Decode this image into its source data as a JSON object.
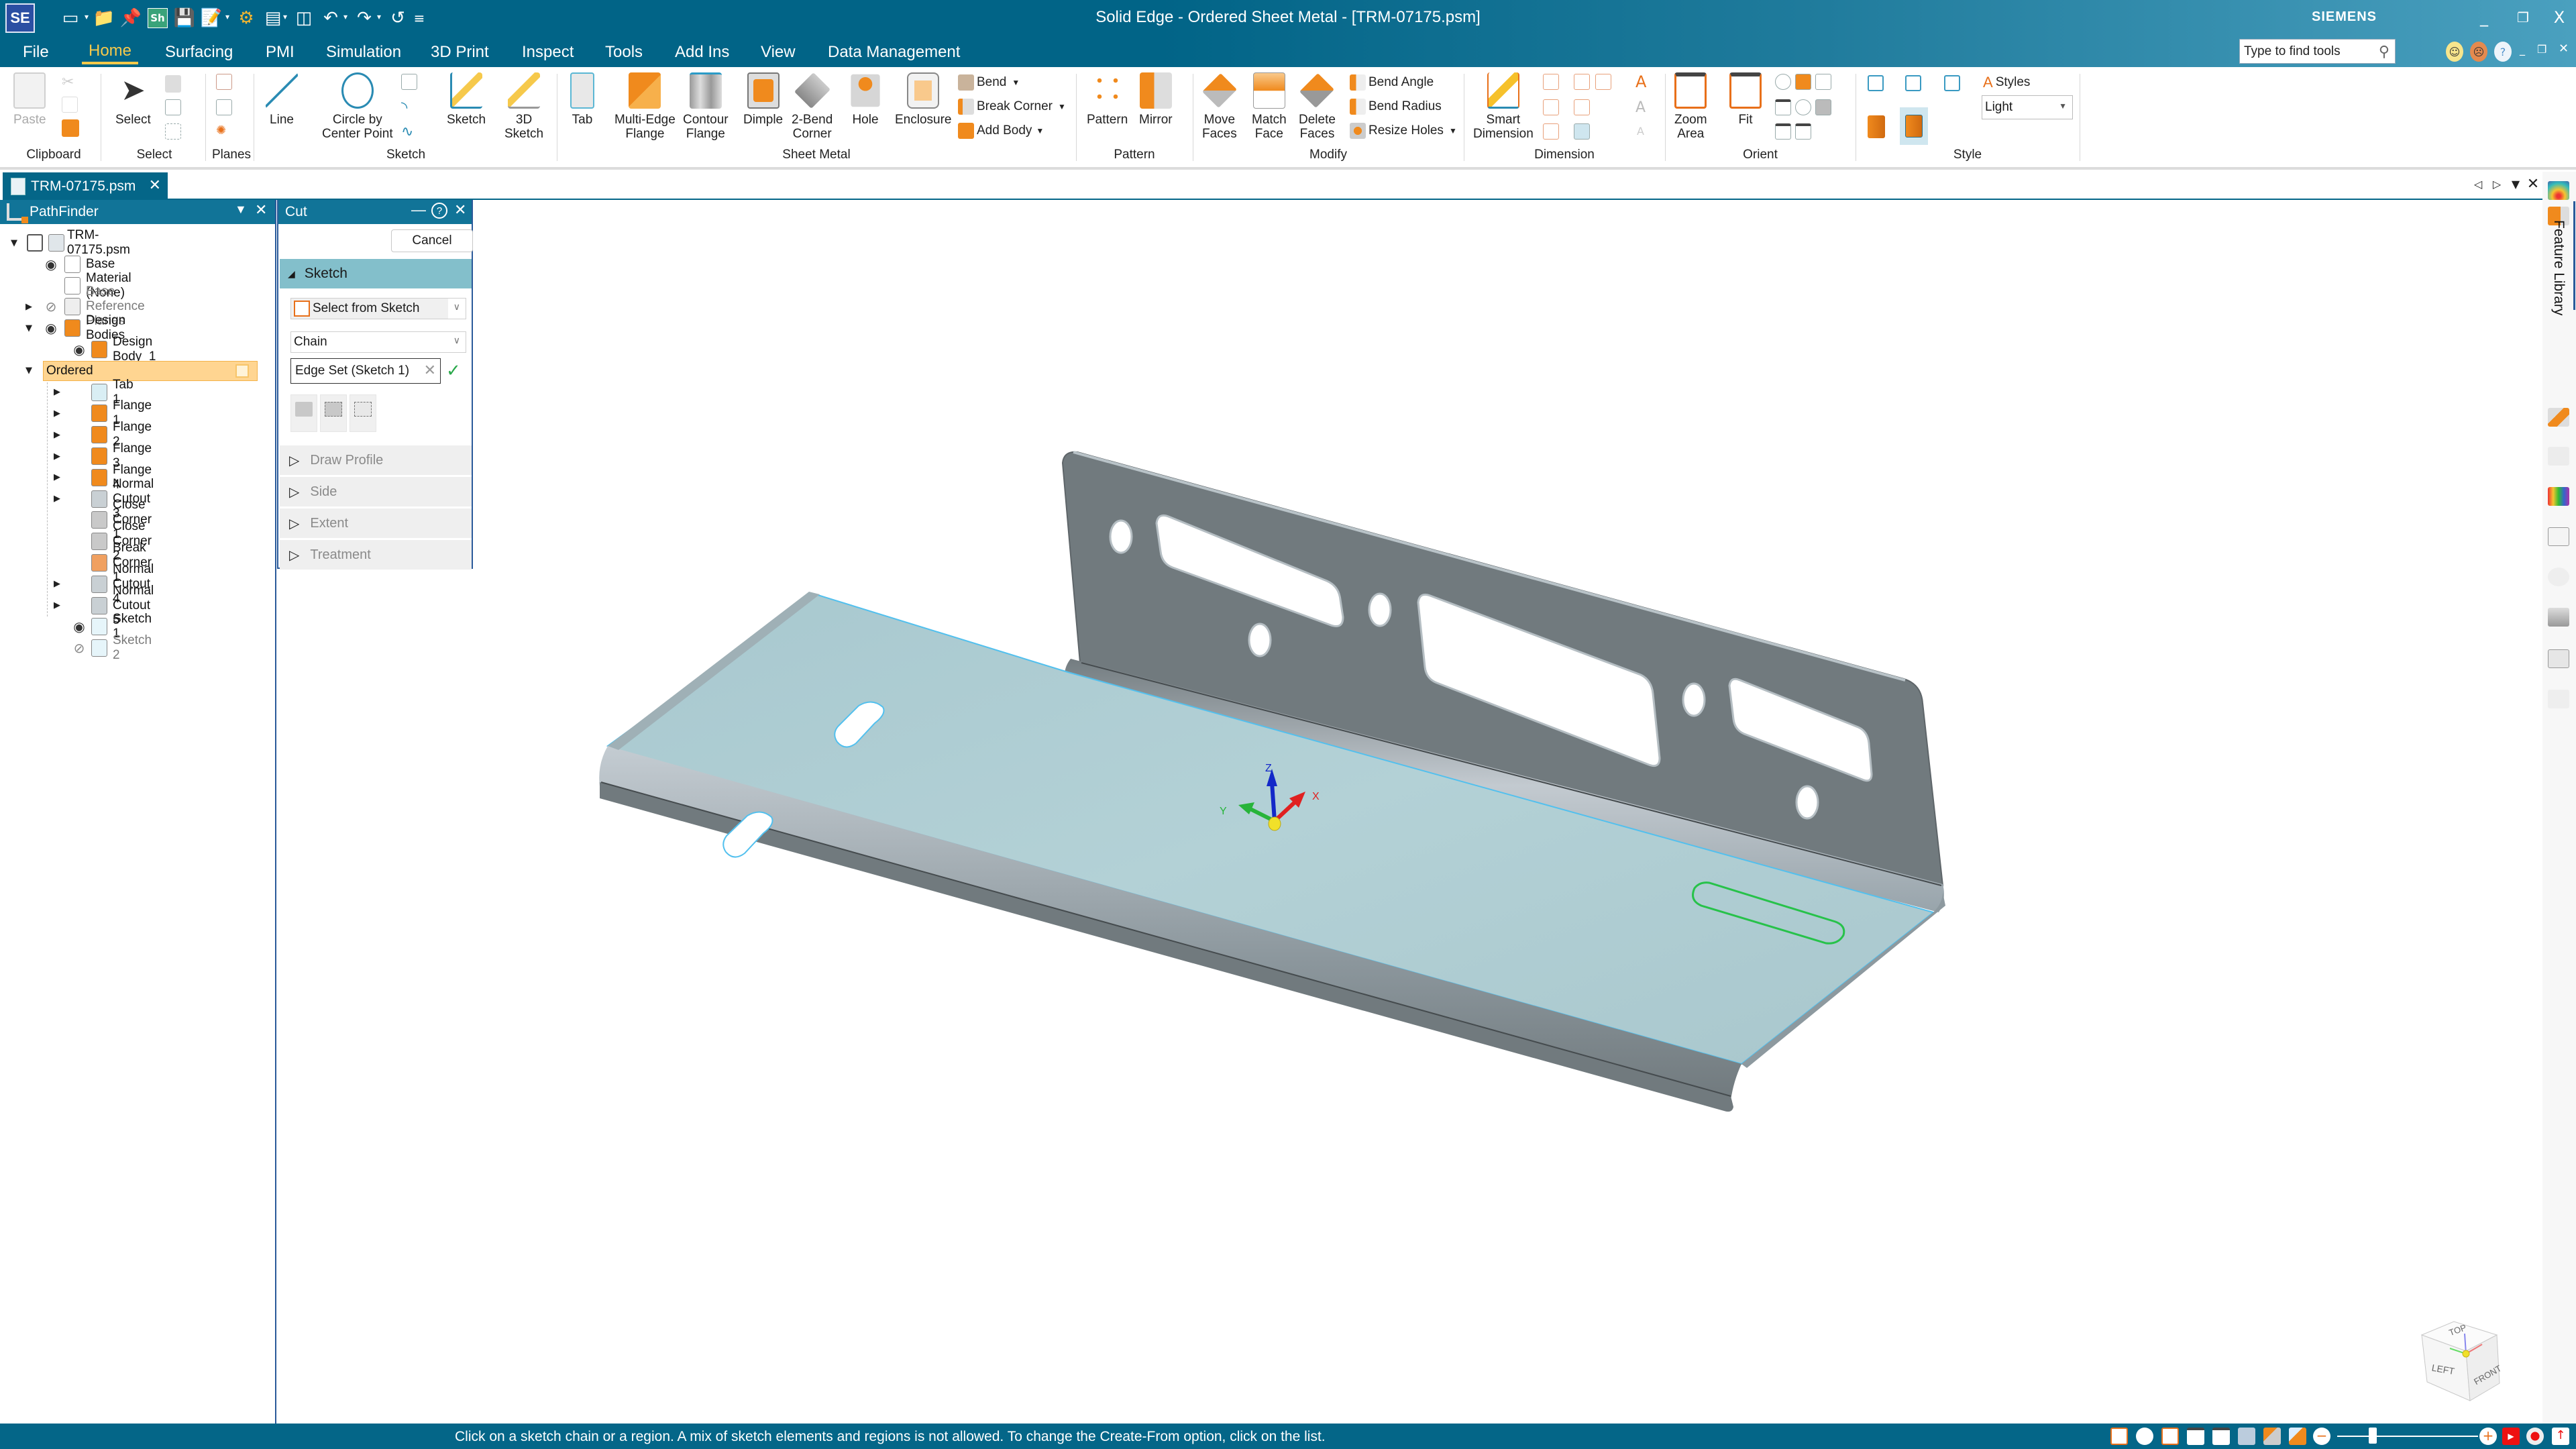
{
  "window": {
    "title": "Solid Edge - Ordered Sheet Metal - [TRM-07175.psm]",
    "brand": "SIEMENS",
    "app_logo": "SE",
    "controls": {
      "minimize": "_",
      "restore": "❐",
      "close": "X"
    }
  },
  "quick_access": [
    {
      "icon": "new-document-icon"
    },
    {
      "icon": "open-folder-icon"
    },
    {
      "icon": "pin-icon"
    },
    {
      "icon": "sheet-icon",
      "label": "Sh"
    },
    {
      "icon": "save-icon"
    },
    {
      "icon": "save-as-icon"
    },
    {
      "icon": "settings-gear-icon"
    },
    {
      "icon": "properties-icon"
    },
    {
      "icon": "close-document-icon"
    },
    {
      "icon": "undo-icon"
    },
    {
      "icon": "redo-icon"
    },
    {
      "icon": "undo-all-icon"
    },
    {
      "icon": "customize-icon"
    }
  ],
  "menu": {
    "tabs": [
      "File",
      "Home",
      "Surfacing",
      "PMI",
      "Simulation",
      "3D Print",
      "Inspect",
      "Tools",
      "Add Ins",
      "View",
      "Data Management"
    ],
    "active": "Home",
    "search_placeholder": "Type to find tools",
    "feedback": {
      "happy": "☺",
      "sad": "☹",
      "help": "?"
    }
  },
  "ribbon": {
    "groups": [
      {
        "label": "Clipboard",
        "items": [
          "Paste"
        ]
      },
      {
        "label": "Select",
        "items": [
          "Select"
        ]
      },
      {
        "label": "Planes",
        "items": []
      },
      {
        "label": "Sketch",
        "items": [
          "Line",
          "Circle by\nCenter Point",
          "Sketch",
          "3D\nSketch"
        ]
      },
      {
        "label": "Sheet Metal",
        "items": [
          "Tab",
          "Multi-Edge\nFlange",
          "Contour\nFlange",
          "Dimple",
          "2-Bend\nCorner",
          "Hole",
          "Enclosure"
        ],
        "small": [
          "Bend",
          "Break Corner",
          "Add Body"
        ]
      },
      {
        "label": "Pattern",
        "items": [
          "Pattern",
          "Mirror"
        ]
      },
      {
        "label": "Modify",
        "items": [
          "Move\nFaces",
          "Match\nFace",
          "Delete\nFaces"
        ],
        "small": [
          "Bend Angle",
          "Bend Radius",
          "Resize Holes"
        ]
      },
      {
        "label": "Dimension",
        "items": [
          "Smart\nDimension"
        ]
      },
      {
        "label": "Orient",
        "items": [
          "Zoom\nArea",
          "Fit"
        ]
      },
      {
        "label": "Style",
        "items": [],
        "small": [
          "Styles"
        ],
        "style_value": "Light"
      }
    ]
  },
  "document_tab": {
    "label": "TRM-07175.psm",
    "close": "✕"
  },
  "tabstrip_nav": {
    "prev": "◁",
    "next": "▷",
    "menu": "▼",
    "close": "✕"
  },
  "pathfinder": {
    "title": "PathFinder",
    "tree": [
      {
        "label": "TRM-07175.psm",
        "level": 0,
        "expander": "open",
        "icon": "part-file-icon"
      },
      {
        "label": "Base",
        "level": 1,
        "eye": "visible",
        "icon": "coordinate-system-icon"
      },
      {
        "label": "Material (None)",
        "level": 1,
        "icon": "material-icon"
      },
      {
        "label": "Base Reference Planes",
        "level": 1,
        "expander": "closed",
        "eye": "hidden",
        "icon": "reference-planes-icon",
        "dim": true
      },
      {
        "label": "Design Bodies",
        "level": 1,
        "expander": "open",
        "eye": "visible",
        "icon": "design-bodies-icon"
      },
      {
        "label": "Design Body_1",
        "level": 2,
        "eye": "visible",
        "icon": "design-body-icon"
      },
      {
        "label": "Ordered",
        "level": 1,
        "expander": "open",
        "highlight": true
      },
      {
        "label": "Tab 1",
        "level": 3,
        "expander": "closed",
        "icon": "tab-feature-icon"
      },
      {
        "label": "Flange 1",
        "level": 3,
        "expander": "closed",
        "icon": "flange-icon"
      },
      {
        "label": "Flange 2",
        "level": 3,
        "expander": "closed",
        "icon": "flange-icon"
      },
      {
        "label": "Flange 3",
        "level": 3,
        "expander": "closed",
        "icon": "flange-icon"
      },
      {
        "label": "Flange 4",
        "level": 3,
        "expander": "closed",
        "icon": "flange-icon"
      },
      {
        "label": "Normal Cutout 3",
        "level": 3,
        "expander": "closed",
        "icon": "normal-cutout-icon"
      },
      {
        "label": "Close Corner 1",
        "level": 3,
        "icon": "close-corner-icon"
      },
      {
        "label": "Close Corner 2",
        "level": 3,
        "icon": "close-corner-icon"
      },
      {
        "label": "Break Corner 1",
        "level": 3,
        "icon": "break-corner-icon"
      },
      {
        "label": "Normal Cutout 4",
        "level": 3,
        "expander": "closed",
        "icon": "normal-cutout-icon"
      },
      {
        "label": "Normal Cutout 5",
        "level": 3,
        "expander": "closed",
        "icon": "normal-cutout-icon"
      },
      {
        "label": "Sketch 1",
        "level": 3,
        "eye": "visible",
        "icon": "sketch-icon"
      },
      {
        "label": "Sketch 2",
        "level": 3,
        "eye": "hidden",
        "icon": "sketch-icon",
        "dim": true
      }
    ]
  },
  "cut_panel": {
    "title": "Cut",
    "cancel": "Cancel",
    "sketch_section": "Sketch",
    "create_from": "Select from Sketch",
    "select_mode": "Chain",
    "selection": "Edge Set (Sketch 1)",
    "collapsed_sections": [
      "Draw Profile",
      "Side",
      "Extent",
      "Treatment"
    ]
  },
  "right_dock": {
    "feature_library": "Feature Library",
    "icons": [
      "heatmap-icon",
      "feature-library-icon",
      "layers-blocks-icon",
      "tools-select-icon",
      "gauge-icon",
      "color-palette-icon",
      "link-icon",
      "layers-icon",
      "settings-panel-icon",
      "hierarchy-icon"
    ]
  },
  "viewport": {
    "triad": {
      "x": "X",
      "y": "Y",
      "z": "Z"
    },
    "viewcube": {
      "top": "TOP",
      "left": "LEFT",
      "front": "FRONT"
    },
    "colors": {
      "part_gray": "#717a7e",
      "selected_face": "#abc9cf",
      "highlight_edge": "#52c0ee",
      "sketch_green": "#27c24a"
    }
  },
  "status": {
    "prompt": "Click on a sketch chain or a region. A mix of sketch elements and regions is not allowed. To change the Create-From option, click on the list.",
    "zoom_slider": 0.25
  },
  "theme": {
    "accent": "#046688",
    "active_tab": "#f7c94a",
    "ordered_highlight": "#ffd591",
    "section_teal": "#83bfcb"
  }
}
